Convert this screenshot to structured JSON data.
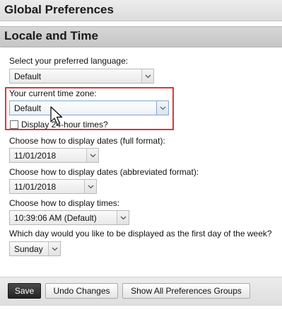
{
  "header": {
    "title": "Global Preferences"
  },
  "section": {
    "title": "Locale and Time"
  },
  "language": {
    "label": "Select your preferred language:",
    "value": "Default"
  },
  "timezone": {
    "label": "Your current time zone:",
    "value": "Default"
  },
  "display24": {
    "label": "Display 24-hour times?",
    "checked": false
  },
  "date_full": {
    "label": "Choose how to display dates (full format):",
    "value": "11/01/2018"
  },
  "date_abbr": {
    "label": "Choose how to display dates (abbreviated format):",
    "value": "11/01/2018"
  },
  "times": {
    "label": "Choose how to display times:",
    "value": "10:39:06 AM (Default)"
  },
  "first_day": {
    "label": "Which day would you like to be displayed as the first day of the week?",
    "value": "Sunday"
  },
  "buttons": {
    "save": "Save",
    "undo": "Undo Changes",
    "show_all": "Show All Preferences Groups"
  },
  "colors": {
    "highlight_border": "#d23b3b",
    "primary_button": "#2e2e2e",
    "focus_border": "#7ea6d8"
  },
  "icons": {
    "dropdown": "chevron-down-icon",
    "cursor": "mouse-pointer-icon"
  }
}
